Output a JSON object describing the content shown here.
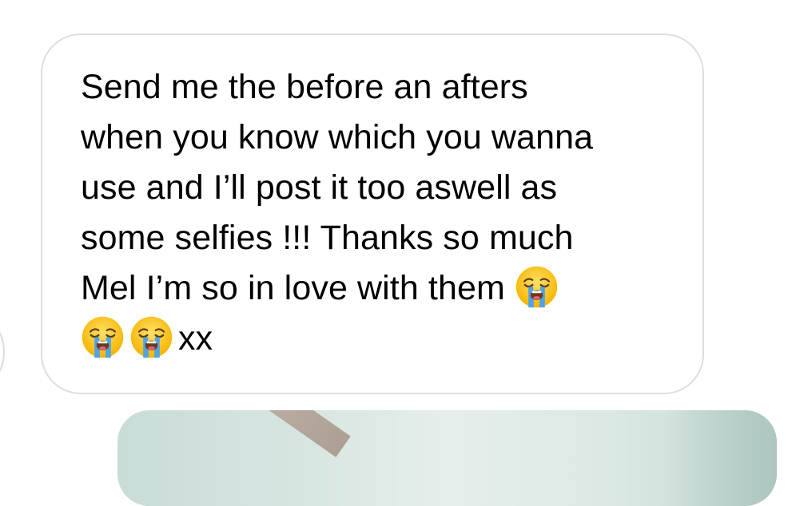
{
  "message": {
    "line1": "Send me the before an afters",
    "line2": "when you know which you wanna",
    "line3": "use and I’ll post it too aswell as",
    "line4": "some selfies !!! Thanks so much",
    "line5": "Mel I’m so in love with them",
    "line6_suffix": "xx",
    "emoji_name": "loudly-crying-face-emoji"
  },
  "colors": {
    "bubble_border": "#dedede",
    "text": "#000000",
    "background": "#ffffff"
  }
}
